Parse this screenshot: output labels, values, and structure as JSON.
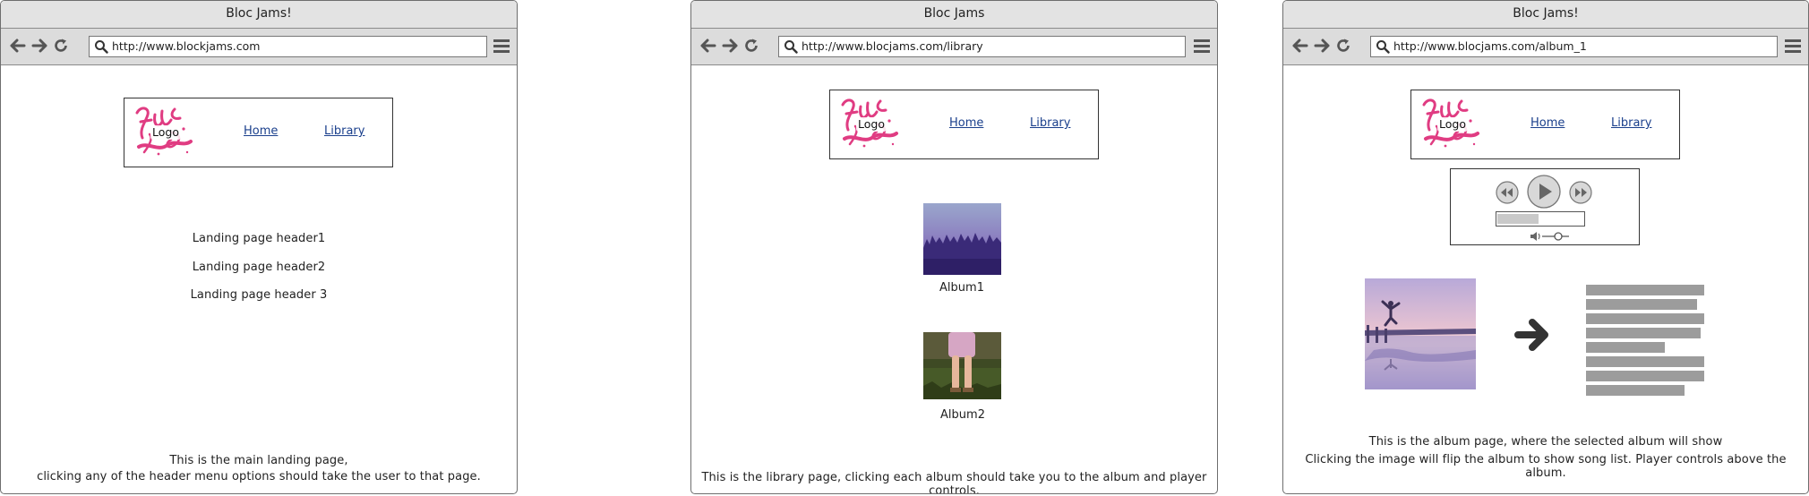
{
  "windows": [
    {
      "title": "Bloc Jams!",
      "url": "http://www.blockjams.com",
      "header": {
        "logo_label": "Logo",
        "nav_home": "Home",
        "nav_library": "Library"
      },
      "landing_headers": [
        "Landing page header1",
        "Landing page header2",
        "Landing page header 3"
      ],
      "notes": [
        "This is the main landing page,",
        "clicking any of the header menu options should take the user to that page."
      ]
    },
    {
      "title": "Bloc Jams",
      "url": "http://www.blocjams.com/library",
      "header": {
        "logo_label": "Logo",
        "nav_home": "Home",
        "nav_library": "Library"
      },
      "albums": [
        {
          "label": "Album1",
          "image": "misty-forest-photo"
        },
        {
          "label": "Album2",
          "image": "person-in-grass-photo"
        }
      ],
      "notes": [
        "This is the library page, clicking each album should take  you to the album and player controls."
      ]
    },
    {
      "title": "Bloc Jams!",
      "url": "http://www.blocjams.com/album_1",
      "header": {
        "logo_label": "Logo",
        "nav_home": "Home",
        "nav_library": "Library"
      },
      "player": {
        "controls": [
          "rewind-icon",
          "play-icon",
          "fast-forward-icon"
        ],
        "progress": 0.48,
        "volume_icon": "speaker-icon",
        "volume_level": 0.6
      },
      "album_image": "person-jumping-on-pier-photo",
      "flip_icon": "arrow-right-icon",
      "song_list_line_count": 8,
      "notes": [
        "This is the album page, where the selected album will show",
        "Clicking the image will flip the album to show song list. Player controls above the album."
      ]
    }
  ],
  "colors": {
    "titlebar_bg": "#e3e3e3",
    "toolbar_bg": "#dcdcdc",
    "link": "#1a3f8c",
    "logo_pink": "#e03c82",
    "song_line": "#9c9c9c"
  }
}
